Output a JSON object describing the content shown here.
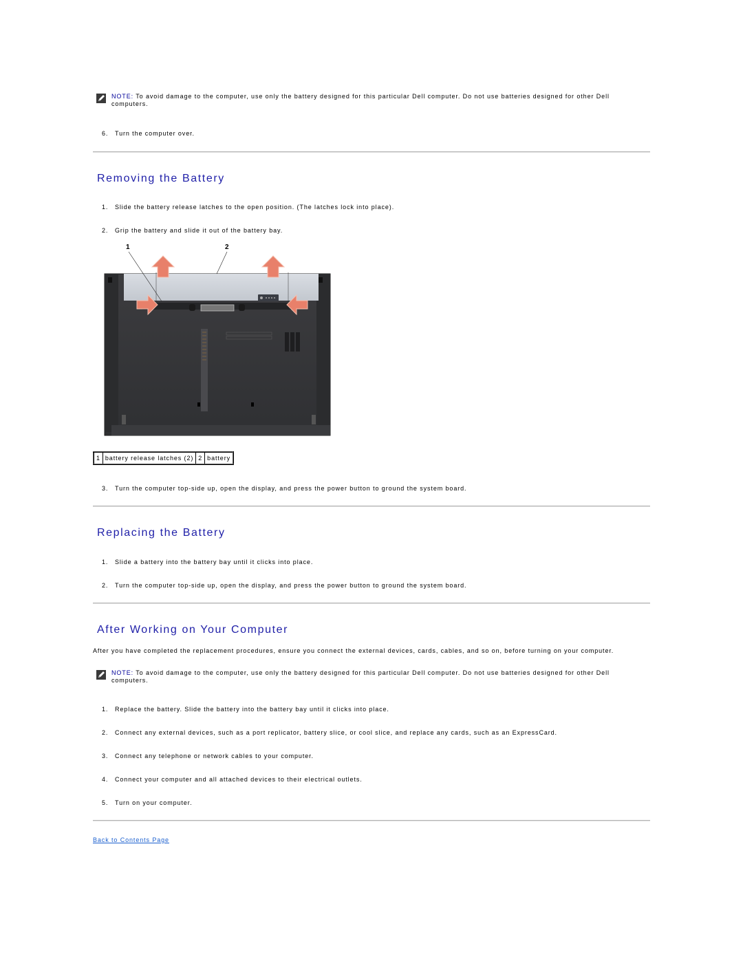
{
  "notes": {
    "label": "NOTE:",
    "text": " To avoid damage to the computer, use only the battery designed for this particular Dell computer. Do not use batteries designed for other Dell computers.",
    "icon": "note-pencil-icon"
  },
  "intro_step": {
    "num": "6.",
    "text": "Turn the computer over."
  },
  "removing": {
    "title": "Removing the Battery",
    "steps": [
      {
        "num": "1.",
        "text": "Slide the battery release latches to the open position. (The latches lock into place)."
      },
      {
        "num": "2.",
        "text": "Grip the battery and slide it out of the battery bay."
      },
      {
        "num": "3.",
        "text": "Turn the computer top-side up, open the display, and press the power button to ground the system board."
      }
    ],
    "figure": {
      "alt": "Bottom view of laptop showing battery release latches and battery with arrows",
      "callout_numbers": [
        "1",
        "2"
      ]
    },
    "callouts": [
      {
        "num": "1",
        "label": "battery release latches (2)"
      },
      {
        "num": "2",
        "label": "battery"
      }
    ]
  },
  "replacing": {
    "title": "Replacing the Battery",
    "steps": [
      {
        "num": "1.",
        "text": "Slide a battery into the battery bay until it clicks into place."
      },
      {
        "num": "2.",
        "text": "Turn the computer top-side up, open the display, and press the power button to ground the system board."
      }
    ]
  },
  "after": {
    "title": "After Working on Your Computer",
    "intro": "After you have completed the replacement procedures, ensure you connect the external devices, cards, cables, and so on, before turning on your computer.",
    "steps": [
      {
        "num": "1.",
        "text": "Replace the battery. Slide the battery into the battery bay until it clicks into place."
      },
      {
        "num": "2.",
        "text": "Connect any external devices, such as a port replicator, battery slice, or cool slice, and replace any cards, such as an ExpressCard."
      },
      {
        "num": "3.",
        "text": "Connect any telephone or network cables to your computer."
      },
      {
        "num": "4.",
        "text": "Connect your computer and all attached devices to their electrical outlets."
      },
      {
        "num": "5.",
        "text": "Turn on your computer."
      }
    ]
  },
  "footer": {
    "back_link": "Back to Contents Page"
  },
  "colors": {
    "heading": "#1f1fa8",
    "note_label": "#000099",
    "link": "#1a5fcf",
    "arrow": "#e8806a"
  }
}
